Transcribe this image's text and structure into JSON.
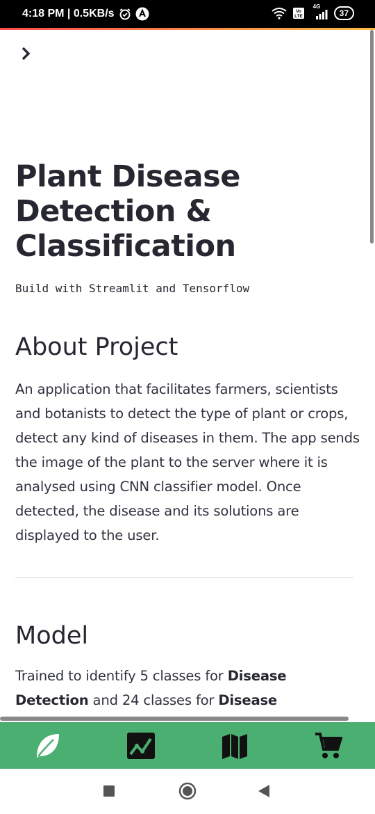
{
  "status_bar": {
    "time_speed": "4:18 PM | 0.5KB/s",
    "network": "4G",
    "volte": "Vo LTE",
    "battery": "37"
  },
  "page": {
    "title": "Plant Disease Detection & Classification",
    "subtitle": "Build with Streamlit and Tensorflow",
    "about_heading": "About Project",
    "about_text": "An application that facilitates farmers, scientists and botanists to detect the type of plant or crops, detect any kind of diseases in them. The app sends the image of the plant to the server where it is analysed using CNN classifier model. Once detected, the disease and its solutions are displayed to the user.",
    "model_heading": "Model",
    "model_text": {
      "part1": "Trained to identify 5 classes for ",
      "bold1": "Disease Detection",
      "part2": " and 24 classes for ",
      "bold2": "Disease"
    }
  },
  "bottom_nav": {
    "items": [
      {
        "icon": "leaf-icon"
      },
      {
        "icon": "chart-icon"
      },
      {
        "icon": "map-icon"
      },
      {
        "icon": "cart-icon"
      }
    ],
    "background": "#4caf72"
  },
  "colors": {
    "accent_start": "#ff4b4b",
    "accent_end": "#ffbd45",
    "text": "#262730"
  }
}
